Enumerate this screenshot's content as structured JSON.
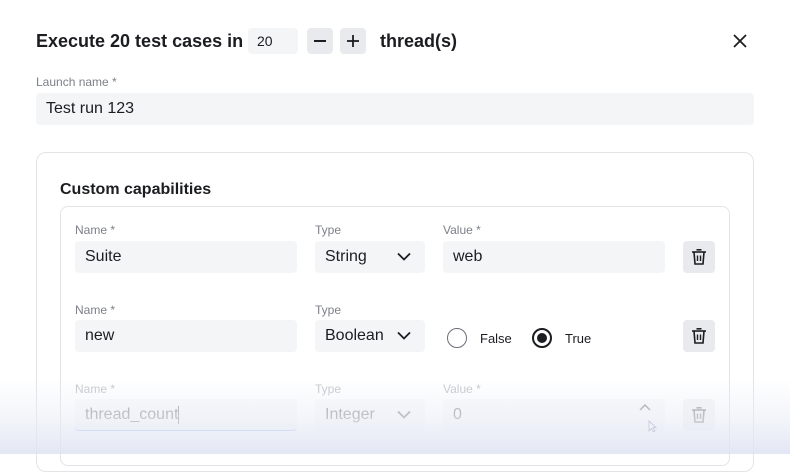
{
  "header": {
    "title": "Execute 20 test cases in",
    "threads_value": "20",
    "threads_suffix": "thread(s)",
    "minus_icon": "minus-icon",
    "plus_icon": "plus-icon",
    "close_icon": "close-icon"
  },
  "launch": {
    "label": "Launch name *",
    "value": "Test run  123"
  },
  "capabilities": {
    "title": "Custom capabilities",
    "rows": [
      {
        "name_label": "Name *",
        "name_value": "Suite",
        "type_label": "Type",
        "type_value": "String",
        "value_label": "Value *",
        "value_value": "web",
        "delete_icon": "trash-icon"
      },
      {
        "name_label": "Name *",
        "name_value": "new",
        "type_label": "Type",
        "type_value": "Boolean",
        "false_label": "False",
        "true_label": "True",
        "selected": "True",
        "delete_icon": "trash-icon"
      },
      {
        "name_label": "Name *",
        "name_value": "thread_count",
        "type_label": "Type",
        "type_value": "Integer",
        "value_label": "Value *",
        "value_value": "0",
        "delete_icon": "trash-icon"
      }
    ]
  },
  "colors": {
    "text": "#1c1d21",
    "label": "#7d8089",
    "field_bg": "#f4f5f7",
    "button_bg": "#e9eaed",
    "border": "#e3e4e8"
  }
}
